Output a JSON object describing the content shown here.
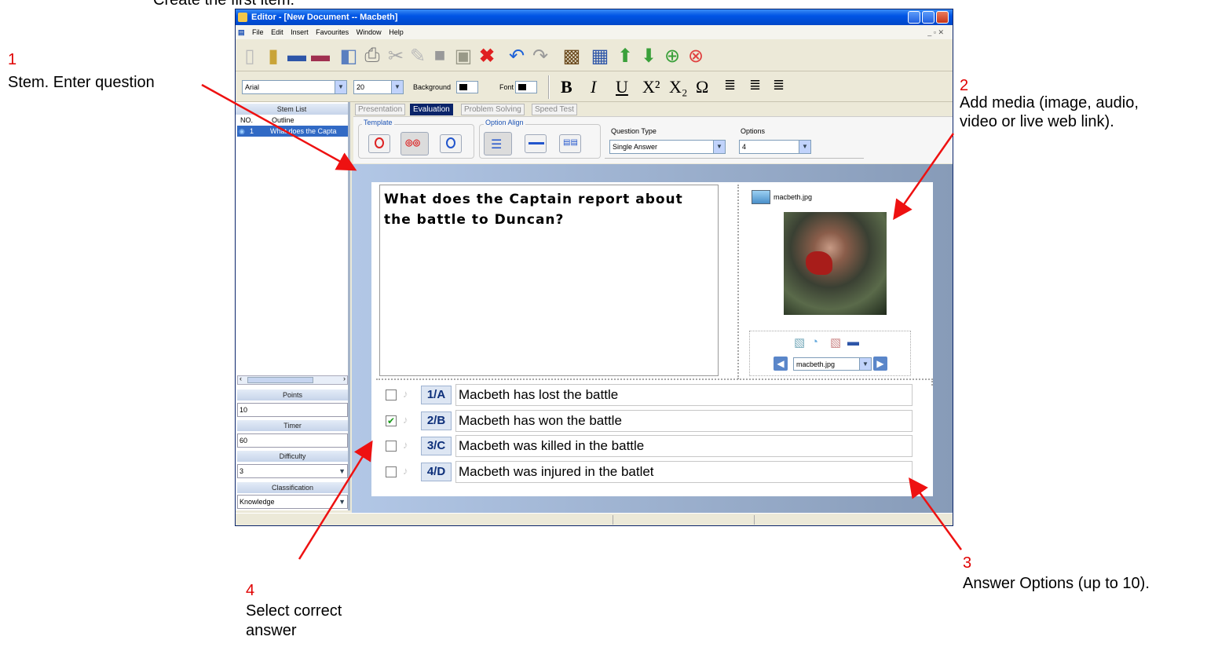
{
  "heading": "Create the first item:",
  "window": {
    "title": "Editor - [New Document -- Macbeth]",
    "menu": [
      "File",
      "Edit",
      "Insert",
      "Favourites",
      "Window",
      "Help"
    ]
  },
  "format_bar": {
    "font_name": "Arial",
    "font_size": "20",
    "background_label": "Background",
    "font_label": "Font",
    "bold": "B",
    "italic": "I",
    "underline": "U",
    "superscript": "X²",
    "subscript": "X₂",
    "omega": "Ω"
  },
  "left_panel": {
    "stem_list_title": "Stem List",
    "col_no": "NO.",
    "col_outline": "Outline",
    "row_no": "1",
    "row_outline": "What does the Capta",
    "points_label": "Points",
    "points_value": "10",
    "timer_label": "Timer",
    "timer_value": "60",
    "difficulty_label": "Difficulty",
    "difficulty_value": "3",
    "classification_label": "Classification",
    "classification_value": "Knowledge"
  },
  "tabs": [
    "Presentation",
    "Evaluation",
    "Problem Solving",
    "Speed Test"
  ],
  "active_tab": "Evaluation",
  "question_panel": {
    "template_label": "Template",
    "option_align_label": "Option Align",
    "question_type_label": "Question Type",
    "question_type_value": "Single Answer",
    "options_label": "Options",
    "options_value": "4"
  },
  "stem_text": "What does the Captain report about the battle to Duncan?",
  "media": {
    "file_name": "macbeth.jpg",
    "selector_value": "macbeth.jpg"
  },
  "options": [
    {
      "label": "1/A",
      "text": "Macbeth has lost the battle",
      "checked": false
    },
    {
      "label": "2/B",
      "text": "Macbeth has won the battle",
      "checked": true
    },
    {
      "label": "3/C",
      "text": "Macbeth was killed in the battle",
      "checked": false
    },
    {
      "label": "4/D",
      "text": "Macbeth was injured in the batlet",
      "checked": false
    }
  ],
  "annotations": {
    "a1_num": "1",
    "a1_text": "Stem.  Enter question",
    "a2_num": "2",
    "a2_line1": "Add media (image, audio,",
    "a2_line2": "video or live web link).",
    "a3_num": "3",
    "a3_text": "Answer Options (up to 10).",
    "a4_num": "4",
    "a4_line1": "Select correct",
    "a4_line2": "answer"
  },
  "colors": {
    "annotation_red": "#e00000",
    "title_blue": "#0055e5",
    "badge_blue": "#0d2f7a"
  }
}
